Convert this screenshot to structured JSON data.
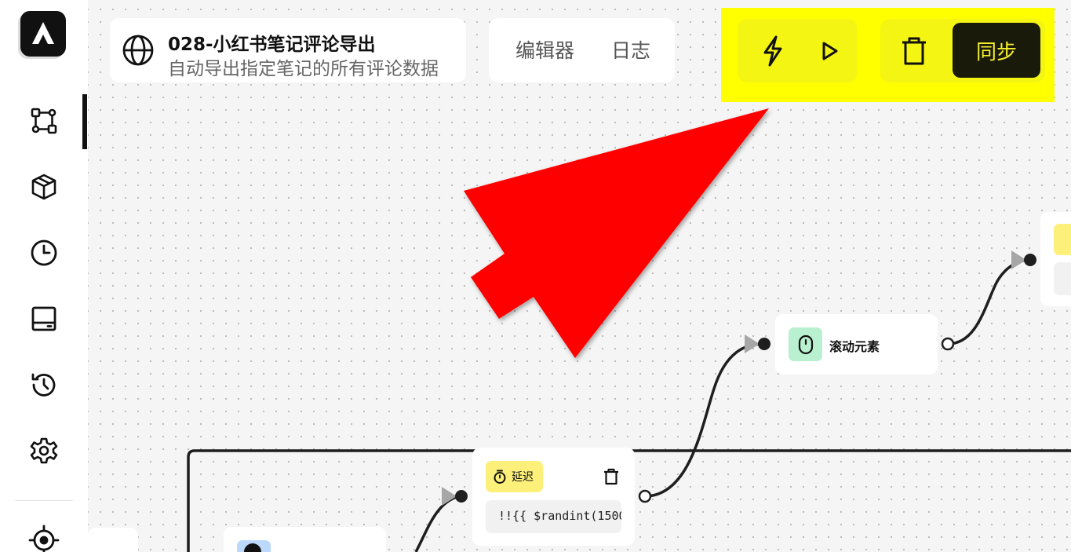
{
  "app": {
    "title": "028-小红书笔记评论导出",
    "subtitle": "自动导出指定笔记的所有评论数据"
  },
  "tabs": [
    {
      "label": "编辑器"
    },
    {
      "label": "日志"
    }
  ],
  "toolbar": {
    "sync_label": "同步",
    "icons": [
      "lightning-icon",
      "play-icon",
      "trash-icon"
    ]
  },
  "sidebar": {
    "items": [
      {
        "name": "workflow",
        "icon": "workflow-icon",
        "active": true
      },
      {
        "name": "packages",
        "icon": "package-icon"
      },
      {
        "name": "schedule",
        "icon": "clock-icon"
      },
      {
        "name": "panel",
        "icon": "panel-icon"
      },
      {
        "name": "history",
        "icon": "history-icon"
      },
      {
        "name": "settings",
        "icon": "gear-icon"
      },
      {
        "name": "target",
        "icon": "crosshair-icon"
      }
    ]
  },
  "nodes": {
    "scroll": {
      "label": "滚动元素",
      "icon": "mouse-icon"
    },
    "delay": {
      "badge": "延迟",
      "icon": "timer-icon",
      "value": "!!{{ $randint(1500"
    }
  },
  "colors": {
    "highlight": "#ffff00",
    "arrow": "#ff0000",
    "sync_bg": "#1a1a0a",
    "sync_text": "#f5f02c",
    "scroll_icon_bg": "#b9f0cf",
    "delay_badge_bg": "#fdf07a"
  }
}
